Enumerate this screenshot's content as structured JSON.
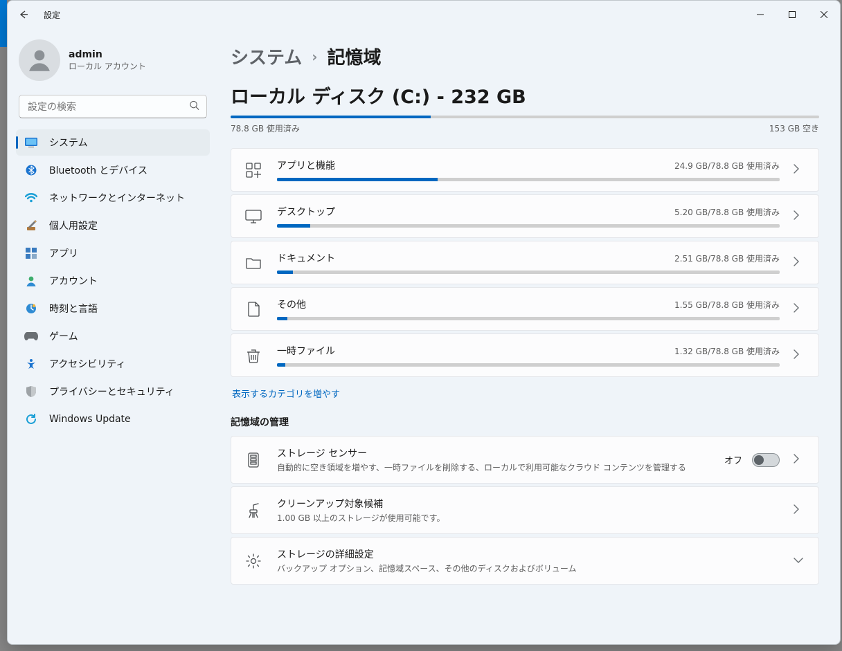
{
  "window": {
    "title": "設定"
  },
  "profile": {
    "name": "admin",
    "sub": "ローカル アカウント"
  },
  "search": {
    "placeholder": "設定の検索"
  },
  "sidebar": {
    "items": [
      {
        "id": "system",
        "label": "システム",
        "active": true
      },
      {
        "id": "bluetooth",
        "label": "Bluetooth とデバイス"
      },
      {
        "id": "network",
        "label": "ネットワークとインターネット"
      },
      {
        "id": "personal",
        "label": "個人用設定"
      },
      {
        "id": "apps",
        "label": "アプリ"
      },
      {
        "id": "account",
        "label": "アカウント"
      },
      {
        "id": "time",
        "label": "時刻と言語"
      },
      {
        "id": "game",
        "label": "ゲーム"
      },
      {
        "id": "access",
        "label": "アクセシビリティ"
      },
      {
        "id": "privacy",
        "label": "プライバシーとセキュリティ"
      },
      {
        "id": "update",
        "label": "Windows Update"
      }
    ]
  },
  "breadcrumb": {
    "parent": "システム",
    "current": "記憶域"
  },
  "disk": {
    "title": "ローカル ディスク (C:) - 232 GB",
    "used_label": "78.8 GB 使用済み",
    "free_label": "153 GB 空き",
    "used_pct": 34
  },
  "categories": [
    {
      "id": "apps",
      "title": "アプリと機能",
      "value": "24.9 GB/78.8 GB 使用済み",
      "pct": 32
    },
    {
      "id": "desktop",
      "title": "デスクトップ",
      "value": "5.20 GB/78.8 GB 使用済み",
      "pct": 6.6
    },
    {
      "id": "docs",
      "title": "ドキュメント",
      "value": "2.51 GB/78.8 GB 使用済み",
      "pct": 3.2
    },
    {
      "id": "other",
      "title": "その他",
      "value": "1.55 GB/78.8 GB 使用済み",
      "pct": 2.0
    },
    {
      "id": "temp",
      "title": "一時ファイル",
      "value": "1.32 GB/78.8 GB 使用済み",
      "pct": 1.7
    }
  ],
  "show_more": "表示するカテゴリを増やす",
  "manage": {
    "heading": "記憶域の管理",
    "items": [
      {
        "id": "sensor",
        "title": "ストレージ センサー",
        "sub": "自動的に空き領域を増やす、一時ファイルを削除する、ローカルで利用可能なクラウド コンテンツを管理する",
        "toggle": true,
        "toggle_state": "オフ",
        "chevron": "right"
      },
      {
        "id": "cleanup",
        "title": "クリーンアップ対象候補",
        "sub": "1.00 GB 以上のストレージが使用可能です。",
        "chevron": "right"
      },
      {
        "id": "advanced",
        "title": "ストレージの詳細設定",
        "sub": "バックアップ オプション、記憶域スペース、その他のディスクおよびボリューム",
        "chevron": "down"
      }
    ]
  }
}
